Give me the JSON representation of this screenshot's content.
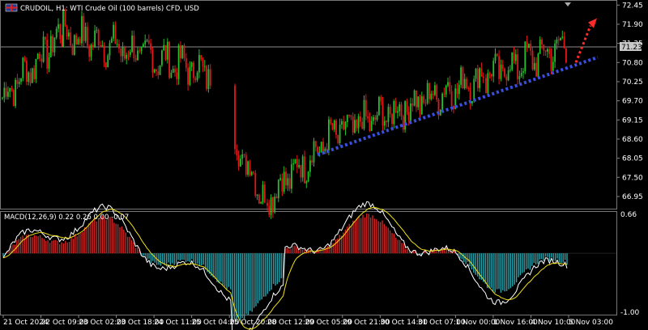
{
  "main_header": {
    "symbol_title": "CRUDOIL, H1:  WTI Crude Oil (100 barrels) CFD, USD",
    "flag_icon": "uk-flag-icon"
  },
  "price_axis": {
    "labels": [
      "72.45",
      "71.90",
      "71.35",
      "70.80",
      "70.25",
      "69.70",
      "69.15",
      "68.60",
      "68.05",
      "67.50",
      "66.95"
    ],
    "current_price": "71.23",
    "current_price_bg": "#c8c8c8"
  },
  "macd_header": {
    "label": "MACD(12,26,9) 0.22 0.26 0.00 -0.07"
  },
  "macd_axis": {
    "top": "0.66",
    "bottom": "-1.00"
  },
  "time_axis": {
    "labels": [
      "21 Oct 2024",
      "22 Oct 09:00",
      "23 Oct 02:00",
      "23 Oct 18:00",
      "24 Oct 11:00",
      "25 Oct 04:00",
      "25 Oct 20:00",
      "28 Oct 12:00",
      "29 Oct 05:00",
      "29 Oct 21:00",
      "30 Oct 14:00",
      "31 Oct 07:00",
      "1 Nov 00:00",
      "1 Nov 16:00",
      "4 Nov 10:00",
      "5 Nov 03:00"
    ]
  },
  "colors": {
    "bull": "#22c02a",
    "bear": "#e01818",
    "macd_hist_pos": "#d02525",
    "macd_hist_neg": "#2aa6b0",
    "macd_line": "#ffffff",
    "signal_line": "#f2e21a",
    "trendline": "#3a4ee0",
    "arrow": "#ff2a2a",
    "grid": "#666666"
  },
  "chart_data": {
    "type": "candlestick",
    "y_range": [
      66.6,
      72.55
    ],
    "segments": [
      {
        "start_price": 69.8,
        "end_price": 71.65
      },
      {
        "start_price": 71.65,
        "end_price": 70.5
      },
      {
        "start_price": 68.5,
        "end_price": 66.95
      },
      {
        "start_price": 66.95,
        "end_price": 68.75
      },
      {
        "start_price": 68.75,
        "end_price": 70.4
      },
      {
        "start_price": 70.4,
        "end_price": 71.3
      }
    ],
    "trendline": {
      "from_price": 68.15,
      "to_price": 70.95
    },
    "arrow_target_price": 72.0,
    "macd": {
      "range": [
        -1.0,
        0.66
      ]
    }
  }
}
